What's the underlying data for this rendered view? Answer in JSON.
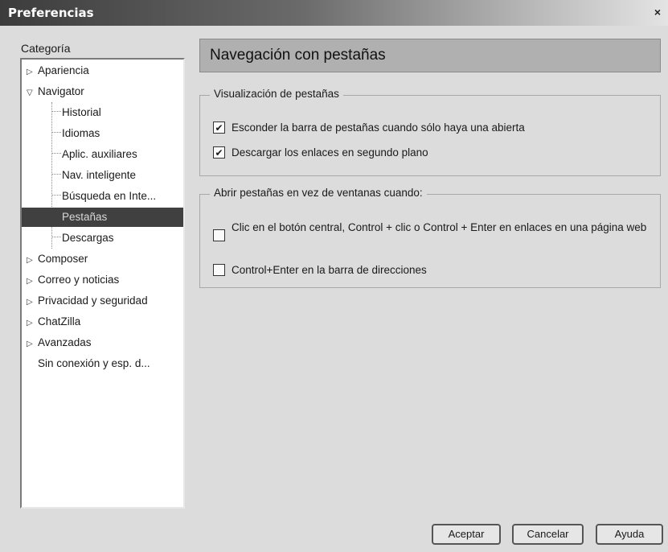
{
  "window": {
    "title": "Preferencias",
    "close_glyph": "×"
  },
  "sidebar": {
    "category_label": "Categoría",
    "items": [
      {
        "label": "Apariencia",
        "expander": "▷"
      },
      {
        "label": "Navigator",
        "expander": "▽"
      },
      {
        "label": "Historial"
      },
      {
        "label": "Idiomas"
      },
      {
        "label": "Aplic. auxiliares"
      },
      {
        "label": "Nav. inteligente"
      },
      {
        "label": "Búsqueda en Inte..."
      },
      {
        "label": "Pestañas",
        "selected": true
      },
      {
        "label": "Descargas"
      },
      {
        "label": "Composer",
        "expander": "▷"
      },
      {
        "label": "Correo y noticias",
        "expander": "▷"
      },
      {
        "label": "Privacidad y seguridad",
        "expander": "▷"
      },
      {
        "label": "ChatZilla",
        "expander": "▷"
      },
      {
        "label": "Avanzadas",
        "expander": "▷"
      },
      {
        "label": "Sin conexión y esp. d..."
      }
    ]
  },
  "main": {
    "title": "Navegación con pestañas",
    "groups": [
      {
        "legend": "Visualización de pestañas",
        "options": [
          {
            "label": "Esconder la barra de pestañas cuando sólo haya una abierta",
            "checked": true
          },
          {
            "label": "Descargar los enlaces en segundo plano",
            "checked": true
          }
        ]
      },
      {
        "legend": "Abrir pestañas en vez de ventanas cuando:",
        "options": [
          {
            "label": "Clic en el botón central, Control + clic o Control + Enter en enlaces en una página web",
            "checked": false
          },
          {
            "label": "Control+Enter en la barra de direcciones",
            "checked": false
          }
        ]
      }
    ]
  },
  "buttons": {
    "ok": "Aceptar",
    "cancel": "Cancelar",
    "help": "Ayuda"
  },
  "colors": {
    "selection": "#404040",
    "header_bg": "#b0b0b0"
  },
  "icons": {
    "check": "✔",
    "expander_collapsed": "▷",
    "expander_expanded": "▽"
  }
}
